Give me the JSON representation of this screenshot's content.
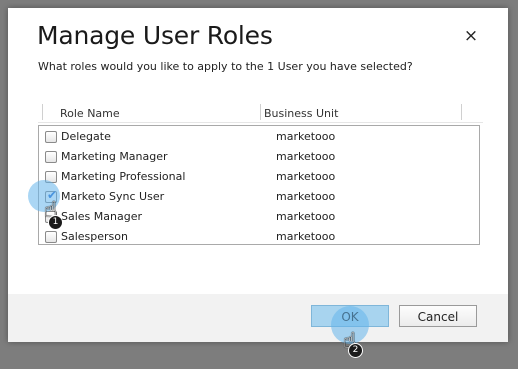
{
  "dialog": {
    "title": "Manage User Roles",
    "subtitle": "What roles would you like to apply to the 1 User you have selected?",
    "close_icon": "×"
  },
  "columns": [
    "Role Name",
    "Business Unit"
  ],
  "rows": [
    {
      "role": "Delegate",
      "unit": "marketooo",
      "checked": false
    },
    {
      "role": "Marketing Manager",
      "unit": "marketooo",
      "checked": false
    },
    {
      "role": "Marketing Professional",
      "unit": "marketooo",
      "checked": false
    },
    {
      "role": "Marketo Sync User",
      "unit": "marketooo",
      "checked": true
    },
    {
      "role": "Sales Manager",
      "unit": "marketooo",
      "checked": false
    },
    {
      "role": "Salesperson",
      "unit": "marketooo",
      "checked": false
    }
  ],
  "footer": {
    "ok_label": "OK",
    "cancel_label": "Cancel"
  },
  "annotations": {
    "step1": "1",
    "step2": "2"
  },
  "colors": {
    "ok_button": "#a8d4ef",
    "highlight": "#64b4eb",
    "overlay": "#7d7d7d"
  },
  "icons": {
    "close": "close-icon",
    "cursor": "hand-pointer-icon"
  }
}
